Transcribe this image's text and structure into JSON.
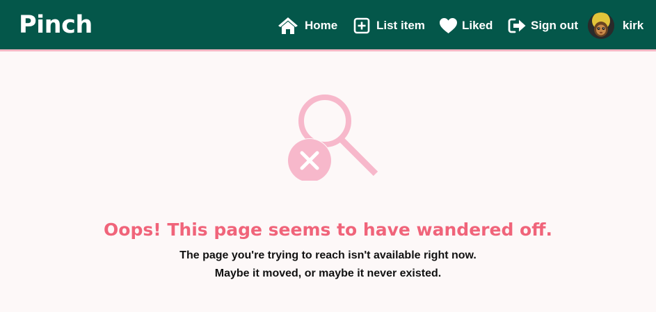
{
  "nav": {
    "brand": "Pinch",
    "items": [
      {
        "label": "Home",
        "icon": "home-icon"
      },
      {
        "label": "List item",
        "icon": "plus-square-icon"
      },
      {
        "label": "Liked",
        "icon": "heart-icon"
      },
      {
        "label": "Sign out",
        "icon": "sign-out-icon"
      }
    ],
    "user": {
      "name": "kirk",
      "avatar": "avatar-image"
    }
  },
  "error": {
    "icon": "search-error-icon",
    "title": "Oops! This page seems to have wandered off.",
    "line1": "The page you're trying to reach isn't available right now.",
    "line2": "Maybe it moved, or maybe it never existed."
  },
  "colors": {
    "nav_bg": "#04574a",
    "nav_border": "#f3b7c4",
    "page_bg": "#fdf8f8",
    "accent": "#f0647a",
    "icon_pink": "#f7b8cb"
  }
}
